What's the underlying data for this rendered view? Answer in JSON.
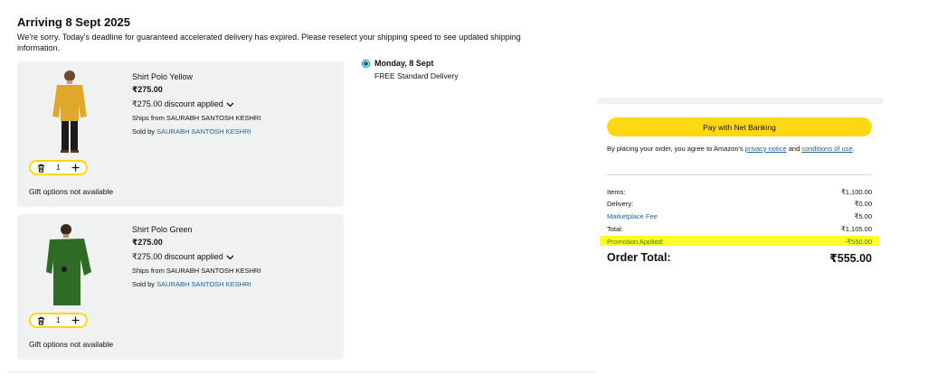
{
  "delivery": {
    "title": "Arriving 8 Sept 2025",
    "message": "We're sorry. Today's deadline for guaranteed accelerated delivery has expired. Please reselect your shipping speed to see updated shipping information."
  },
  "items": [
    {
      "name": "Shirt Polo Yellow",
      "price": "₹275.00",
      "discount": "₹275.00 discount applied",
      "ships_from": "Ships from SAURABH SANTOSH KESHRI",
      "sold_by_label": "Sold by ",
      "seller": "SAURABH SANTOSH KESHRI",
      "quantity": "1",
      "gift": "Gift options not available",
      "shirt_color": "#e0a82a"
    },
    {
      "name": "Shirt Polo Green",
      "price": "₹275.00",
      "discount": "₹275.00 discount applied",
      "ships_from": "Ships from SAURABH SANTOSH KESHRI",
      "sold_by_label": "Sold by ",
      "seller": "SAURABH SANTOSH KESHRI",
      "quantity": "1",
      "gift": "Gift options not available",
      "shirt_color": "#2f6b25"
    }
  ],
  "shipping_option": {
    "day": "Monday, 8 Sept",
    "desc": "FREE Standard Delivery",
    "selected": true
  },
  "summary": {
    "pay_button": "Pay with Net Banking",
    "agree_prefix": "By placing your order, you agree to Amazon's ",
    "privacy_link": "privacy notice",
    "and": " and ",
    "conditions_link": "conditions of use",
    "period": ".",
    "rows": [
      {
        "label": "Items:",
        "value": "₹1,100.00"
      },
      {
        "label": "Delivery:",
        "value": "₹0.00"
      },
      {
        "label": "Marketplace Fee",
        "value": "₹5.00"
      },
      {
        "label": "Total:",
        "value": "₹1,105.00"
      },
      {
        "label": "Promotion Applied:",
        "value": "-₹550.00"
      }
    ],
    "order_total_label": "Order Total:",
    "order_total_value": "₹555.00"
  },
  "icons": {
    "delete": "trash-icon",
    "add": "plus-icon",
    "expand": "chevron-down-icon"
  },
  "colors": {
    "accent_yellow": "#ffd814",
    "link_blue": "#2162a1",
    "radio_teal": "#007185",
    "promo_green": "#427b00",
    "highlight": "#ffff28"
  }
}
